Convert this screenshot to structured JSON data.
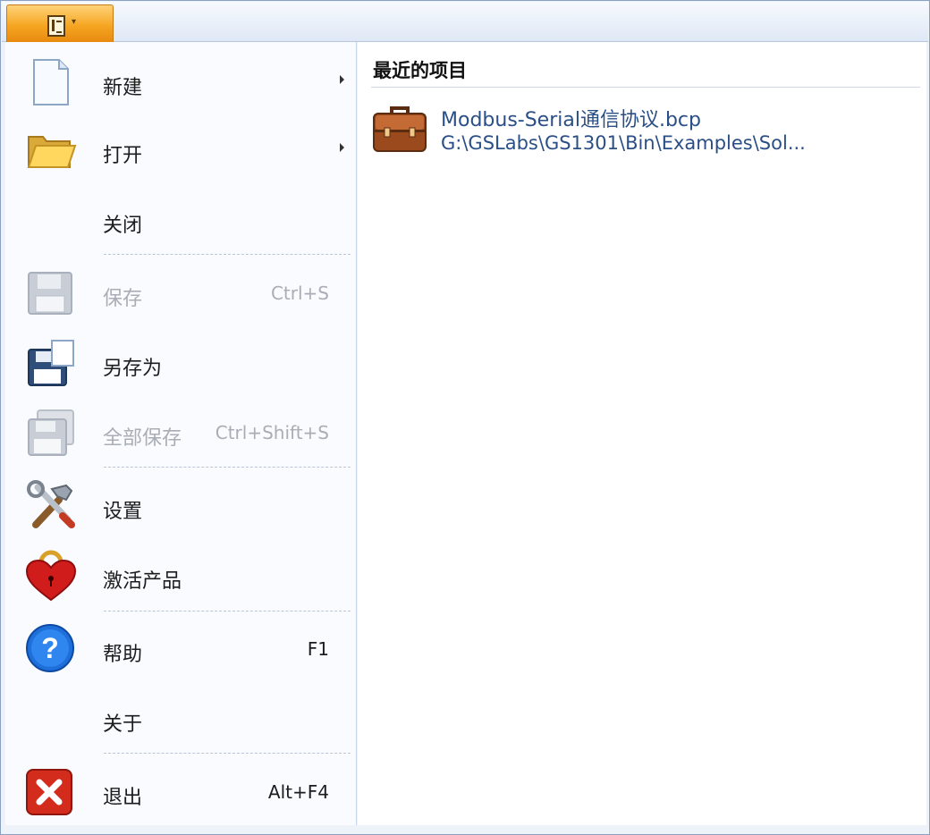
{
  "menu": {
    "items": [
      {
        "label": "新建",
        "shortcut": ""
      },
      {
        "label": "打开",
        "shortcut": ""
      },
      {
        "label": "关闭",
        "shortcut": ""
      },
      {
        "label": "保存",
        "shortcut": "Ctrl+S"
      },
      {
        "label": "另存为",
        "shortcut": ""
      },
      {
        "label": "全部保存",
        "shortcut": "Ctrl+Shift+S"
      },
      {
        "label": "设置",
        "shortcut": ""
      },
      {
        "label": "激活产品",
        "shortcut": ""
      },
      {
        "label": "帮助",
        "shortcut": "F1"
      },
      {
        "label": "关于",
        "shortcut": ""
      },
      {
        "label": "退出",
        "shortcut": "Alt+F4"
      }
    ]
  },
  "recent": {
    "title": "最近的项目",
    "items": [
      {
        "name": "Modbus-Serial通信协议.bcp",
        "path": "G:\\GSLabs\\GS1301\\Bin\\Examples\\Sol..."
      }
    ]
  },
  "icons": {
    "app_menu": "document-menu-icon",
    "new": "new-document-icon",
    "open": "open-folder-icon",
    "save": "floppy-disk-icon",
    "save_as": "save-as-icon",
    "save_all": "save-all-icon",
    "settings": "tools-icon",
    "activate": "heart-lock-icon",
    "help": "help-icon",
    "exit": "exit-icon",
    "recent_project": "briefcase-icon"
  },
  "colors": {
    "app_button": "#f6a622",
    "link_text": "#2a4f86",
    "disabled_text": "#a9adb5"
  }
}
